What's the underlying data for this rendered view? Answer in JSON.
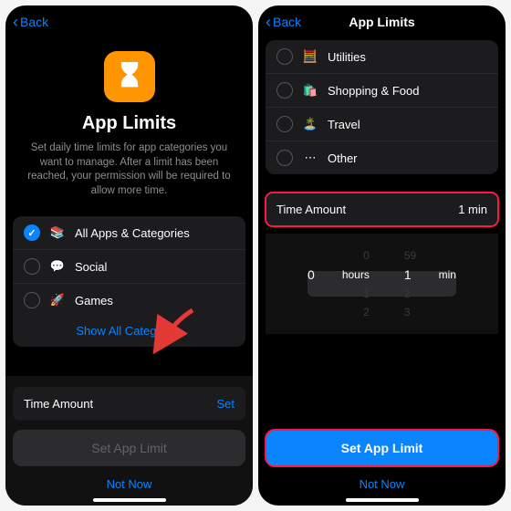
{
  "left": {
    "back": "Back",
    "title": "App Limits",
    "desc": "Set daily time limits for app categories you want to manage. After a limit has been reached, your permission will be required to allow more time.",
    "rows": [
      {
        "label": "All Apps & Categories",
        "icon": "📚",
        "checked": true
      },
      {
        "label": "Social",
        "icon": "💬",
        "checked": false
      },
      {
        "label": "Games",
        "icon": "🚀",
        "checked": false
      }
    ],
    "showAll": "Show All Categories",
    "timeAmountLabel": "Time Amount",
    "timeAmountVal": "Set",
    "setBtn": "Set App Limit",
    "notNow": "Not Now"
  },
  "right": {
    "back": "Back",
    "title": "App Limits",
    "rows": [
      {
        "label": "Utilities",
        "icon": "🧮"
      },
      {
        "label": "Shopping & Food",
        "icon": "🛍️"
      },
      {
        "label": "Travel",
        "icon": "🏝️"
      },
      {
        "label": "Other",
        "icon": "⋯"
      }
    ],
    "timeAmountLabel": "Time Amount",
    "timeAmountVal": "1 min",
    "picker": {
      "hoursBefore": "0",
      "hours": "0",
      "hoursUnit": "hours",
      "minBefore": "59",
      "min": "1",
      "minUnit": "min",
      "hoursAfter1": "1",
      "hoursAfter2": "2",
      "minAfter1": "2",
      "minAfter2": "3"
    },
    "setBtn": "Set App Limit",
    "notNow": "Not Now"
  }
}
